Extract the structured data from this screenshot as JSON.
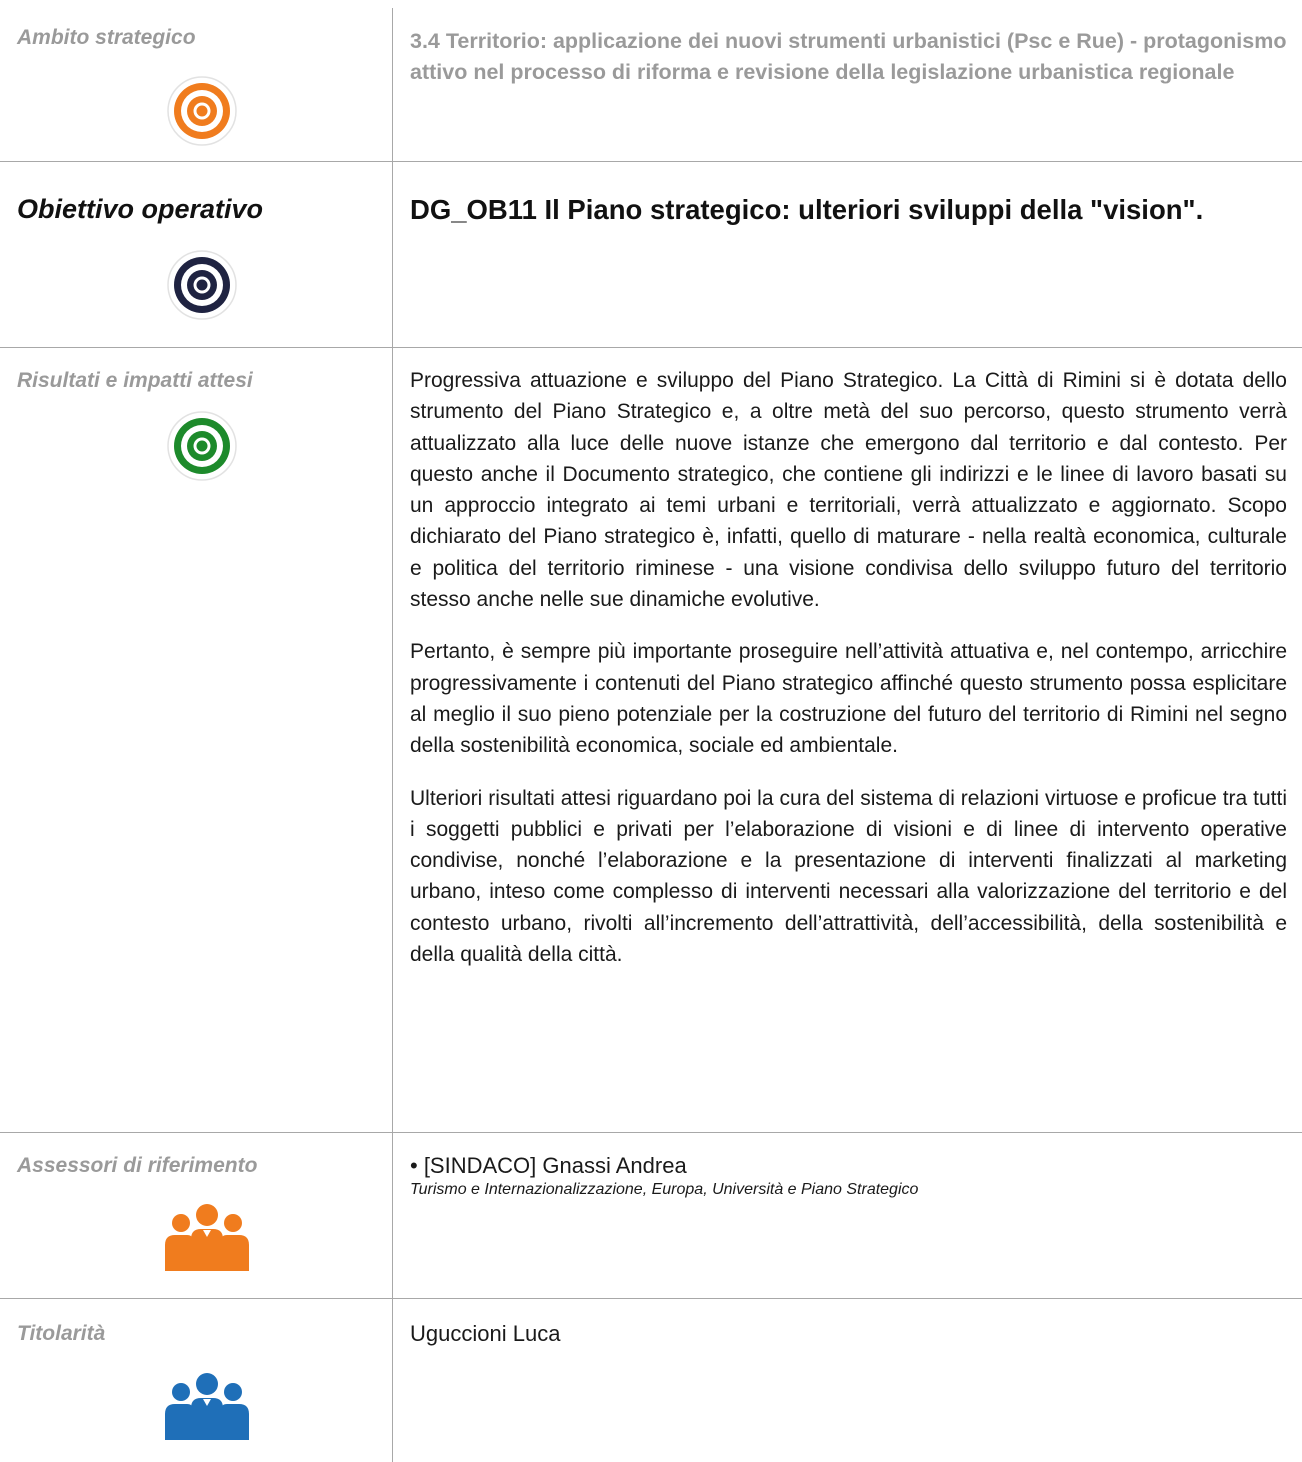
{
  "ambito": {
    "label": "Ambito strategico",
    "text": "3.4 Territorio: applicazione dei nuovi strumenti urbanistici (Psc e Rue) - protagonismo attivo nel processo di riforma e revisione della legislazione urbanistica regionale",
    "icon": "target-icon",
    "color": "#f07c1e"
  },
  "obiettivo": {
    "label": "Obiettivo operativo",
    "text": "DG_OB11 Il Piano strategico: ulteriori sviluppi della \"vision\".",
    "icon": "target-icon",
    "color": "#1f2341"
  },
  "risultati": {
    "label": "Risultati e impatti attesi",
    "icon": "target-icon",
    "color": "#1d8a2b",
    "paragraphs": [
      "Progressiva attuazione e sviluppo del Piano Strategico. La Città di Rimini si è dotata dello strumento del Piano Strategico e, a oltre metà del suo percorso, questo strumento verrà attualizzato alla luce delle nuove istanze che emergono dal territorio e dal contesto. Per questo anche il Documento strategico, che contiene gli indirizzi e le linee di lavoro basati su un approccio integrato ai temi urbani e territoriali, verrà attualizzato e aggiornato. Scopo dichiarato del Piano strategico è, infatti, quello di maturare - nella realtà economica, culturale e politica del territorio riminese - una visione condivisa dello sviluppo futuro del territorio stesso anche nelle sue dinamiche evolutive.",
      "Pertanto, è sempre più importante proseguire nell’attività attuativa e, nel contempo, arricchire progressivamente i contenuti del Piano strategico affinché questo strumento possa esplicitare al meglio il suo pieno potenziale per la costruzione del futuro del territorio di Rimini nel segno della sostenibilità economica, sociale ed ambientale.",
      "Ulteriori risultati attesi riguardano poi la cura del sistema di relazioni virtuose e proficue tra tutti i soggetti pubblici e privati per l’elaborazione di visioni e di linee di intervento operative condivise, nonché l’elaborazione e la presentazione di interventi finalizzati al marketing urbano, inteso come complesso di interventi necessari alla valorizzazione del territorio e del contesto urbano, rivolti all’incremento dell’attrattività, dell’accessibilità, della sostenibilità e della qualità della città."
    ]
  },
  "assessori": {
    "label": "Assessori di riferimento",
    "icon": "people-icon",
    "color": "#f07c1e",
    "name": "• [SINDACO] Gnassi Andrea",
    "role": "Turismo e Internazionalizzazione, Europa, Università e Piano Strategico"
  },
  "titolarita": {
    "label": "Titolarità",
    "icon": "people-icon",
    "color": "#1f6fb8",
    "name": "Uguccioni Luca"
  }
}
